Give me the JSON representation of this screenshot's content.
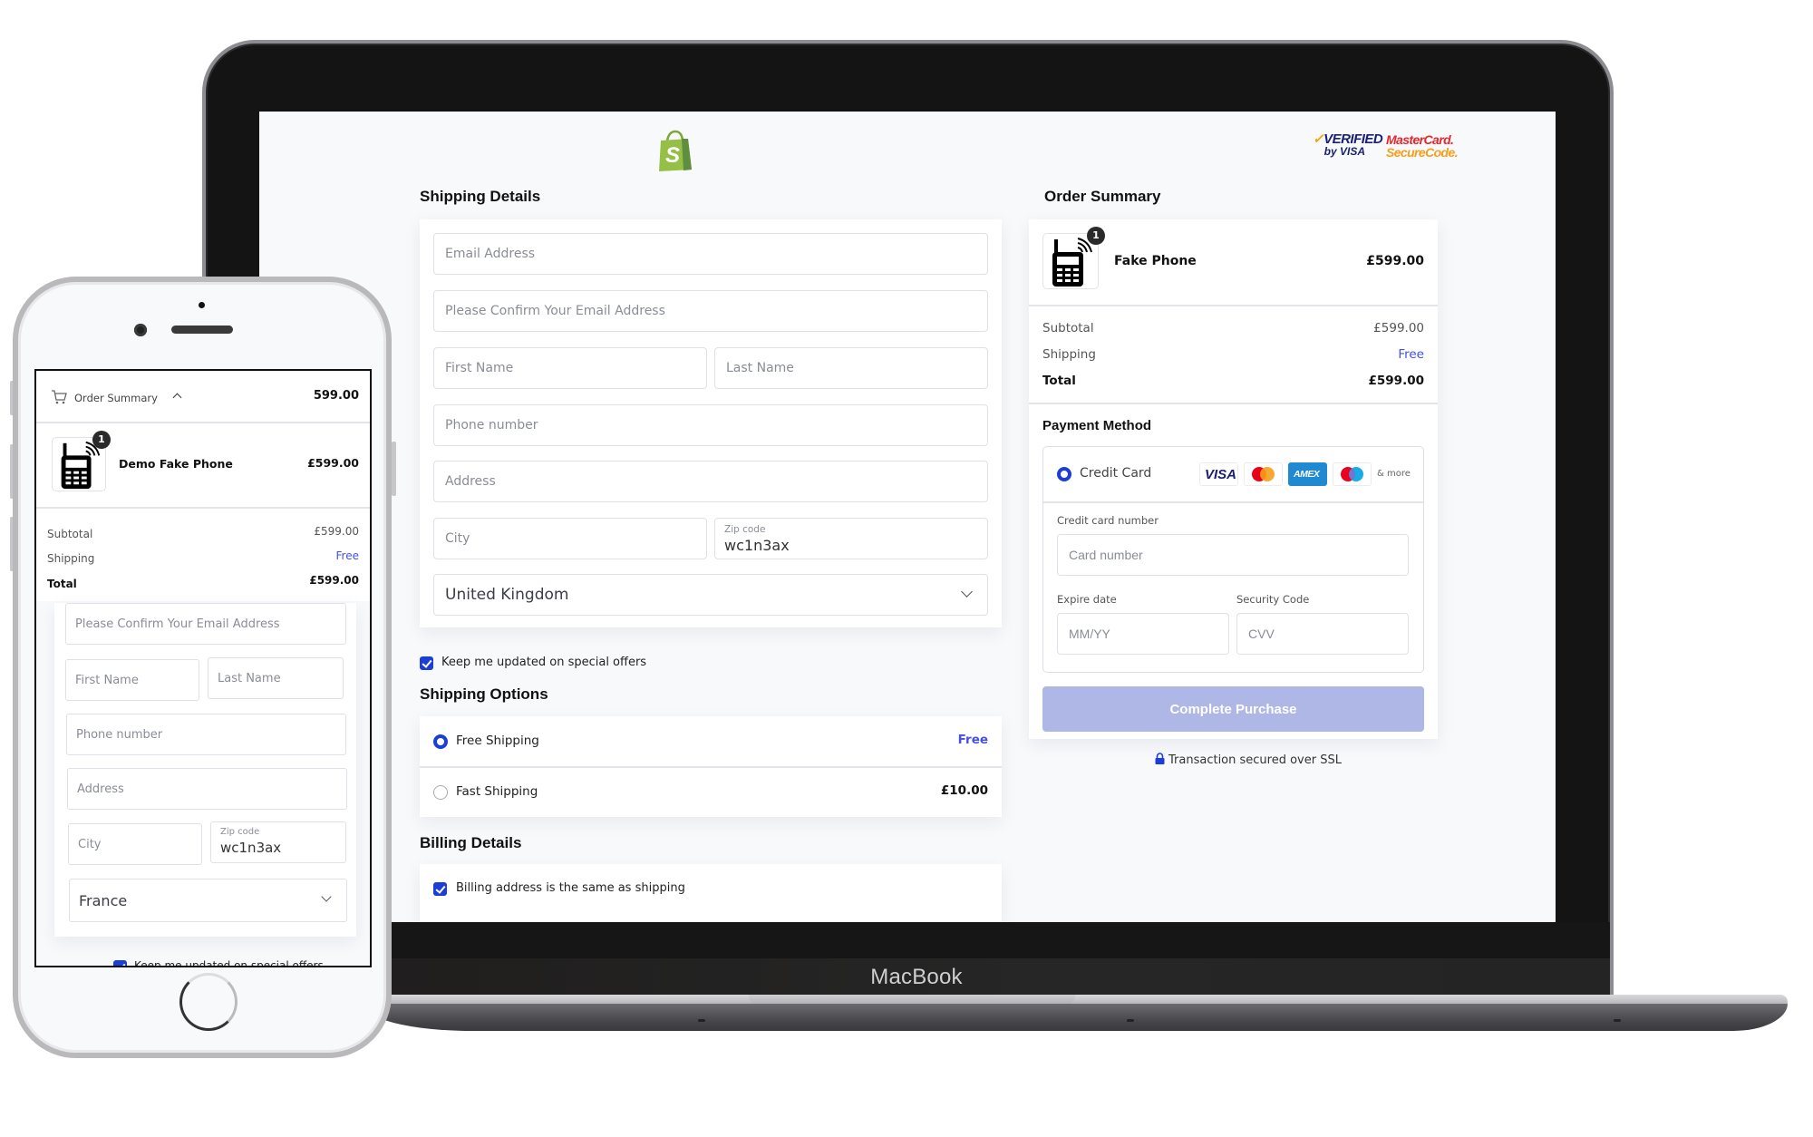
{
  "device": {
    "laptop_label": "MacBook"
  },
  "desktop": {
    "security_badges": {
      "verified_by_visa_line1": "VERIFIED",
      "verified_by_visa_line2": "by VISA",
      "mastercard_line1": "MasterCard.",
      "mastercard_line2": "SecureCode."
    },
    "shipping_details": {
      "heading": "Shipping Details",
      "fields": {
        "email": {
          "placeholder": "Email Address",
          "value": ""
        },
        "confirm_email": {
          "placeholder": "Please Confirm Your Email Address",
          "value": ""
        },
        "first_name": {
          "placeholder": "First Name",
          "value": ""
        },
        "last_name": {
          "placeholder": "Last Name",
          "value": ""
        },
        "phone": {
          "placeholder": "Phone number",
          "value": ""
        },
        "address": {
          "placeholder": "Address",
          "value": ""
        },
        "city": {
          "placeholder": "City",
          "value": ""
        },
        "zip": {
          "label": "Zip code",
          "value": "wc1n3ax"
        },
        "country": {
          "selected": "United Kingdom"
        }
      },
      "newsletter": {
        "label": "Keep me updated on special offers",
        "checked": true
      }
    },
    "shipping_options": {
      "heading": "Shipping Options",
      "options": [
        {
          "label": "Free Shipping",
          "price": "Free",
          "selected": true
        },
        {
          "label": "Fast Shipping",
          "price": "£10.00",
          "selected": false
        }
      ]
    },
    "billing_details": {
      "heading": "Billing Details",
      "same_as_shipping": {
        "label": "Billing address is the same as shipping",
        "checked": true
      }
    },
    "order_summary": {
      "heading": "Order Summary",
      "item": {
        "name": "Fake Phone",
        "price": "£599.00",
        "quantity": "1"
      },
      "subtotal_label": "Subtotal",
      "subtotal": "£599.00",
      "shipping_label": "Shipping",
      "shipping": "Free",
      "total_label": "Total",
      "total": "£599.00"
    },
    "payment": {
      "heading": "Payment Method",
      "method_label": "Credit Card",
      "card_brands": [
        "VISA",
        "Mastercard",
        "AMEX",
        "Maestro"
      ],
      "more_label": "& more",
      "card_number_label": "Credit card number",
      "card_number_placeholder": "Card number",
      "expiry_label": "Expire date",
      "expiry_placeholder": "MM/YY",
      "cvv_label": "Security Code",
      "cvv_placeholder": "CVV",
      "submit_label": "Complete Purchase",
      "ssl_note": "Transaction secured over SSL"
    },
    "colors": {
      "accent": "#1c3ed6",
      "button_disabled": "#aeb7e6",
      "free_text": "#4250e6",
      "shopify_green": "#95bf47"
    }
  },
  "mobile": {
    "summary_bar": {
      "label": "Order Summary",
      "total": "599.00"
    },
    "item": {
      "name": "Demo Fake Phone",
      "price": "£599.00",
      "quantity": "1"
    },
    "subtotal_label": "Subtotal",
    "subtotal": "£599.00",
    "shipping_label": "Shipping",
    "shipping": "Free",
    "total_label": "Total",
    "total": "£599.00",
    "fields": {
      "confirm_email": {
        "placeholder": "Please Confirm Your Email Address"
      },
      "first_name": {
        "placeholder": "First Name"
      },
      "last_name": {
        "placeholder": "Last Name"
      },
      "phone": {
        "placeholder": "Phone number"
      },
      "address": {
        "placeholder": "Address"
      },
      "city": {
        "placeholder": "City"
      },
      "zip": {
        "label": "Zip code",
        "value": "wc1n3ax"
      },
      "country": {
        "selected": "France"
      }
    },
    "newsletter": {
      "label": "Keep me updated on special offers",
      "checked": true
    }
  }
}
